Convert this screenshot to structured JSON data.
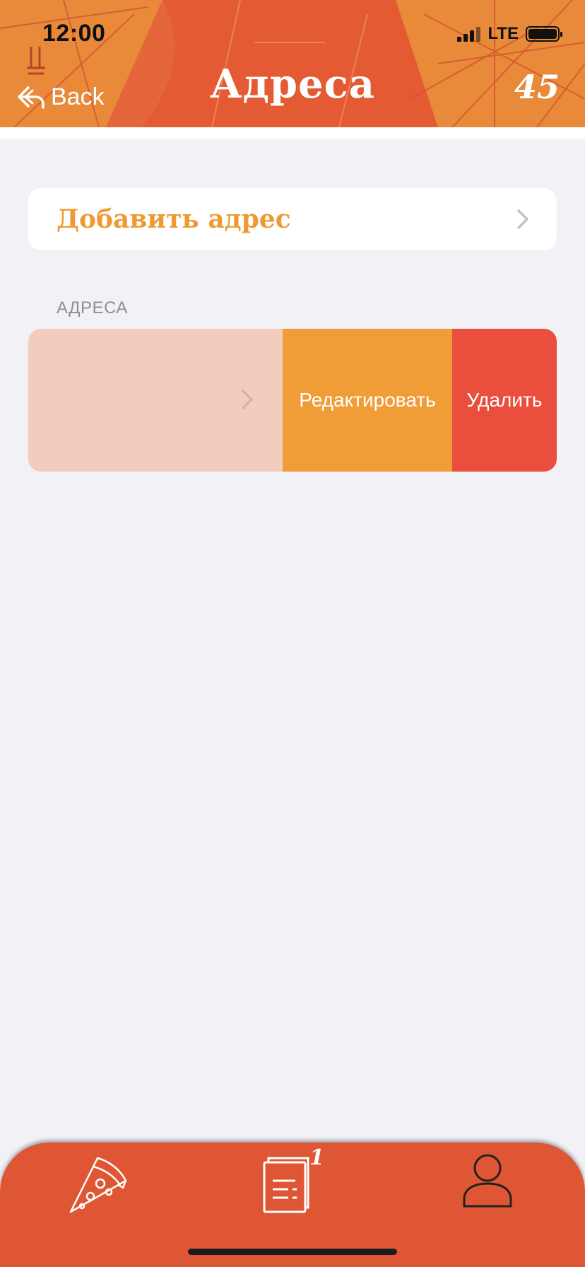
{
  "status_bar": {
    "time": "12:00",
    "network": "LTE"
  },
  "nav": {
    "back_label": "Back",
    "title": "Адреса",
    "counter": "45"
  },
  "add_address": {
    "label": "Добавить адрес"
  },
  "addresses_section": {
    "header": "АДРЕСА",
    "row_actions": {
      "edit": "Редактировать",
      "delete": "Удалить"
    }
  },
  "tab_bar": {
    "orders_badge": "1"
  },
  "colors": {
    "header": "#E35A33",
    "accent_orange": "#EE9A33",
    "edit_action": "#F19D37",
    "delete_action": "#EA4E3C",
    "background": "#F1F1F6"
  },
  "icons": {
    "back": "back-arrow-icon",
    "chevron": "chevron-right-icon",
    "pizza": "pizza-icon",
    "orders": "receipt-icon",
    "profile": "user-icon"
  }
}
